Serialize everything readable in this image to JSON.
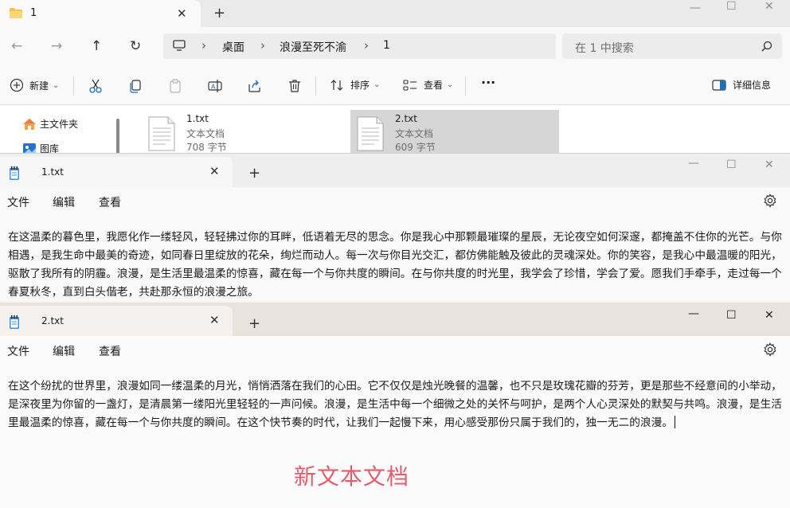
{
  "explorer": {
    "tab_title": "1",
    "tab_close": "✕",
    "tab_new": "+",
    "controls": {
      "minimize": "—",
      "maximize": "☐",
      "close": "✕"
    },
    "nav": {
      "back": "←",
      "forward": "→",
      "up": "↑",
      "refresh": "↻"
    },
    "breadcrumb": [
      "桌面",
      "浪漫至死不渝",
      "1"
    ],
    "breadcrumb_sep": "›",
    "search_placeholder": "在 1 中搜索",
    "commands": {
      "new": "新建",
      "new_arrow": "⌄",
      "sort": "排序",
      "sort_arrow": "⌄",
      "view": "查看",
      "view_arrow": "⌄",
      "more": "···",
      "details": "详细信息"
    },
    "sidebar": [
      {
        "label": "主文件夹",
        "icon": "home-icon"
      },
      {
        "label": "图库",
        "icon": "gallery-icon"
      }
    ],
    "files": [
      {
        "name": "1.txt",
        "type": "文本文档",
        "size": "708 字节",
        "selected": false
      },
      {
        "name": "2.txt",
        "type": "文本文档",
        "size": "609 字节",
        "selected": true
      }
    ]
  },
  "notepad1": {
    "tab_title": "1.txt",
    "tab_close": "✕",
    "tab_new": "+",
    "controls": {
      "minimize": "—",
      "maximize": "☐",
      "close": "✕"
    },
    "menu": [
      "文件",
      "编辑",
      "查看"
    ],
    "content": "在这温柔的暮色里，我愿化作一缕轻风，轻轻拂过你的耳畔，低语着无尽的思念。你是我心中那颗最璀璨的星辰，无论夜空如何深邃，都掩盖不住你的光芒。与你相遇，是我生命中最美的奇迹，如同春日里绽放的花朵，绚烂而动人。每一次与你目光交汇，都仿佛能触及彼此的灵魂深处。你的笑容，是我心中最温暖的阳光，驱散了我所有的阴霾。浪漫，是生活里最温柔的惊喜，藏在每一个与你共度的瞬间。在与你共度的时光里，我学会了珍惜，学会了爱。愿我们手牵手，走过每一个春夏秋冬，直到白头偕老，共赴那永恒的浪漫之旅。"
  },
  "notepad2": {
    "tab_title": "2.txt",
    "tab_close": "✕",
    "tab_new": "+",
    "controls": {
      "minimize": "—",
      "maximize": "☐",
      "close": "✕"
    },
    "menu": [
      "文件",
      "编辑",
      "查看"
    ],
    "content": "在这个纷扰的世界里，浪漫如同一缕温柔的月光，悄悄洒落在我们的心田。它不仅仅是烛光晚餐的温馨，也不只是玫瑰花瓣的芬芳，更是那些不经意间的小举动，是深夜里为你留的一盏灯，是清晨第一缕阳光里轻轻的一声问候。浪漫，是生活中每一个细微之处的关怀与呵护，是两个人心灵深处的默契与共鸣。浪漫，是生活里最温柔的惊喜，藏在每一个与你共度的瞬间。在这个快节奏的时代，让我们一起慢下来，用心感受那份只属于我们的，独一无二的浪漫。",
    "overlay_caption": "新文本文档"
  }
}
